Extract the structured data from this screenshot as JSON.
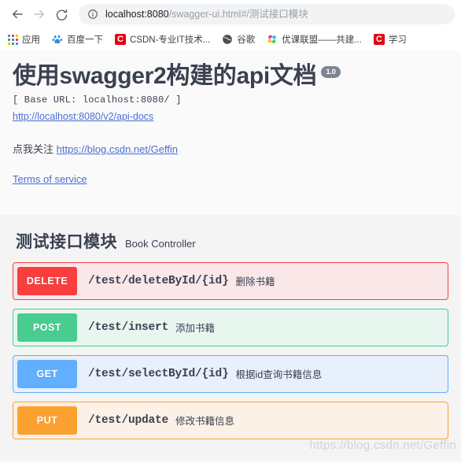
{
  "browser": {
    "back_icon": "back-arrow-icon",
    "forward_icon": "forward-arrow-icon",
    "reload_icon": "reload-icon",
    "site_info_icon": "info-circle-icon",
    "url_host": "localhost:8080",
    "url_path": "/swagger-ui.html#/测试接口模块",
    "url_full": "localhost:8080/swagger-ui.html#/测试接口模块",
    "bookmarks": [
      {
        "label": "应用",
        "icon": "apps-grid-icon"
      },
      {
        "label": "百度一下",
        "icon": "baidu-paw-icon"
      },
      {
        "label": "CSDN-专业IT技术...",
        "icon": "csdn-icon"
      },
      {
        "label": "谷歌",
        "icon": "globe-icon"
      },
      {
        "label": "优课联盟——共建...",
        "icon": "youke-icon"
      },
      {
        "label": "学习",
        "icon": "csdn-icon"
      }
    ]
  },
  "swagger": {
    "title": "使用swagger2构建的api文档",
    "version": "1.0",
    "base_url_line": "[ Base URL: localhost:8080/ ]",
    "api_docs_link": "http://localhost:8080/v2/api-docs",
    "description_prefix": "点我关注 ",
    "description_link": "https://blog.csdn.net/Geffin",
    "terms_label": "Terms of service",
    "tag": {
      "name": "测试接口模块",
      "controller": "Book Controller"
    },
    "operations": [
      {
        "method": "DELETE",
        "path": "/test/deleteById/{id}",
        "summary": "删除书籍",
        "color": "#f93e3e",
        "bg": "#fae7e7"
      },
      {
        "method": "POST",
        "path": "/test/insert",
        "summary": "添加书籍",
        "color": "#49cc90",
        "bg": "#e8f6f0"
      },
      {
        "method": "GET",
        "path": "/test/selectById/{id}",
        "summary": "根据id查询书籍信息",
        "color": "#61affe",
        "bg": "#e8f0fb"
      },
      {
        "method": "PUT",
        "path": "/test/update",
        "summary": "修改书籍信息",
        "color": "#fca130",
        "bg": "#fbf1e6"
      }
    ]
  },
  "watermark": "https://blog.csdn.net/Geffin"
}
